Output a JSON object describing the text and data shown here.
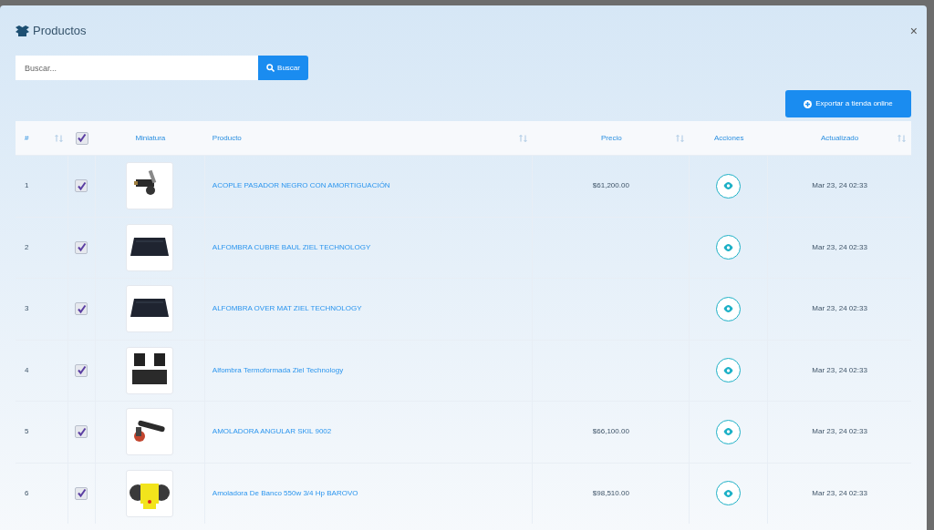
{
  "modal": {
    "title": "Productos",
    "close": "×"
  },
  "search": {
    "placeholder": "Buscar...",
    "button": "Buscar"
  },
  "export_button": "Exportar a tienda online",
  "table": {
    "columns": [
      {
        "label": "#",
        "sortable": true,
        "kind": "text"
      },
      {
        "kind": "checkbox",
        "checked": true
      },
      {
        "label": "Miniatura",
        "sortable": false,
        "kind": "text"
      },
      {
        "label": "Producto",
        "sortable": true,
        "kind": "text"
      },
      {
        "label": "Precio",
        "sortable": true,
        "kind": "text"
      },
      {
        "label": "Acciones",
        "sortable": false,
        "kind": "text"
      },
      {
        "label": "Actualizado",
        "sortable": true,
        "kind": "text"
      }
    ],
    "rows": [
      {
        "number": "1",
        "checked": true,
        "product": "ACOPLE PASADOR NEGRO CON AMORTIGUACIÓN",
        "price": "$61,200.00",
        "updated": "Mar 23, 24 02:33"
      },
      {
        "number": "2",
        "checked": true,
        "product": "ALFOMBRA CUBRE BAUL ZIEL TECHNOLOGY",
        "updated": "Mar 23, 24 02:33"
      },
      {
        "number": "3",
        "checked": true,
        "product": "ALFOMBRA OVER MAT ZIEL TECHNOLOGY",
        "updated": "Mar 23, 24 02:33"
      },
      {
        "number": "4",
        "checked": true,
        "product": "Alfombra Termoformada Ziel Technology",
        "updated": "Mar 23, 24 02:33"
      },
      {
        "number": "5",
        "checked": true,
        "product": "AMOLADORA ANGULAR SKIL 9002",
        "price": "$66,100.00",
        "updated": "Mar 23, 24 02:33"
      },
      {
        "number": "6",
        "checked": true,
        "product": "Amoladora De Banco 550w 3/4 Hp BAROVO",
        "price": "$98,510.00",
        "updated": "Mar 23, 24 02:33"
      }
    ]
  }
}
